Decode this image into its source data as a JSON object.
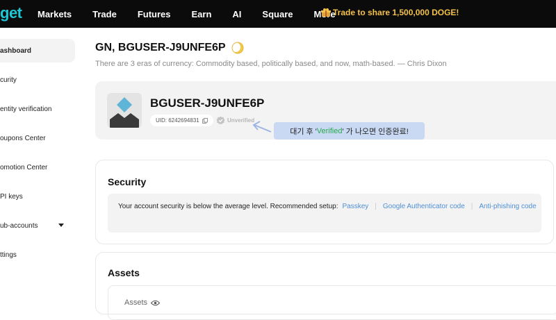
{
  "topbar": {
    "logo": "get",
    "nav": [
      "Markets",
      "Trade",
      "Futures",
      "Earn",
      "AI",
      "Square",
      "More"
    ],
    "promo": "Trade to share 1,500,000 DOGE!"
  },
  "sidebar": {
    "items": [
      {
        "label": "ashboard",
        "active": true
      },
      {
        "label": "curity"
      },
      {
        "label": "entity verification"
      },
      {
        "label": "oupons Center"
      },
      {
        "label": "omotion Center"
      },
      {
        "label": "PI keys"
      },
      {
        "label": "ub-accounts",
        "has_arrow": true
      },
      {
        "label": "ttings"
      }
    ]
  },
  "header": {
    "greeting": "GN, BGUSER-J9UNFE6P",
    "quote": "There are 3 eras of currency: Commodity based, politically based, and now, math-based. — Chris Dixon"
  },
  "profile": {
    "username": "BGUSER-J9UNFE6P",
    "uid": "UID: 6242694831",
    "status": "Unverified"
  },
  "annotation": {
    "prefix": "대기 후 '",
    "highlight": "Verified",
    "suffix": "' 가 나오면 인증완료!"
  },
  "security": {
    "title": "Security",
    "message": "Your account security is below the average level. Recommended setup:",
    "links": [
      "Passkey",
      "Google Authenticator code",
      "Anti-phishing code"
    ]
  },
  "assets": {
    "title": "Assets",
    "label": "Assets"
  },
  "colors": {
    "accent": "#1fc7d4",
    "promo": "#f4c24a",
    "link": "#4f8fd6",
    "verified_green": "#27a94b"
  }
}
